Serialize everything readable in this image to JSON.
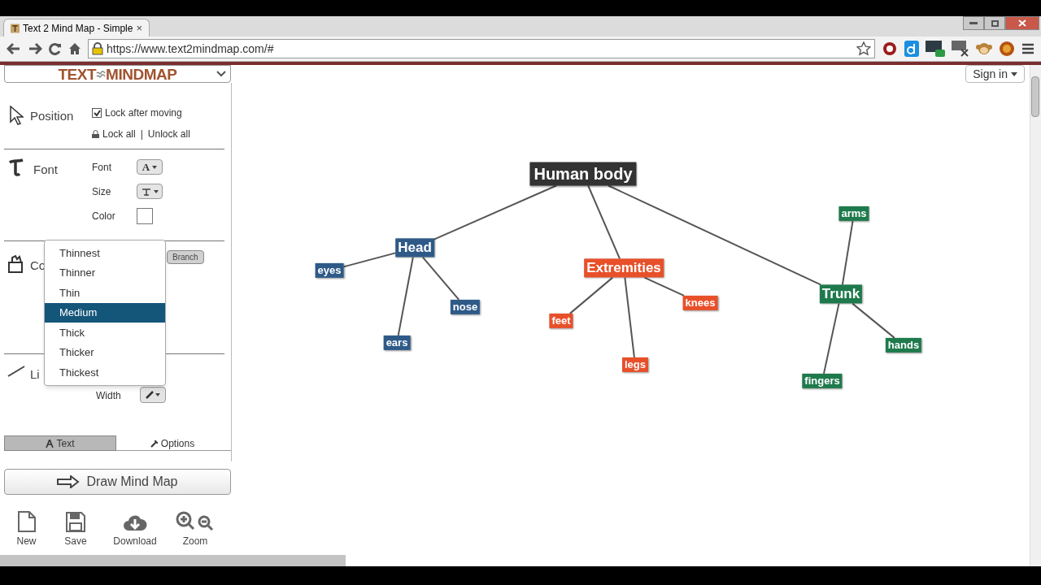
{
  "browser": {
    "tab": {
      "title": "Text 2 Mind Map - Simple",
      "close": "×"
    },
    "url": "https://www.text2mindmap.com/#"
  },
  "logo": {
    "left": "TEXT",
    "right": "MINDMAP"
  },
  "sign_in": "Sign in",
  "position": {
    "title": "Position",
    "lock_after_moving": {
      "label": "Lock after moving",
      "checked": true
    },
    "lock_all": "Lock all",
    "separator": "|",
    "unlock_all": "Unlock all"
  },
  "font": {
    "title": "Font",
    "fields": [
      {
        "label": "Font",
        "kind": "letter",
        "value": "A"
      },
      {
        "label": "Size",
        "kind": "size"
      },
      {
        "label": "Color",
        "kind": "swatch"
      }
    ]
  },
  "color_section": {
    "title": "Co",
    "branch_button": "Branch"
  },
  "line_section": {
    "title": "Li",
    "width_label": "Width"
  },
  "width_menu": {
    "items": [
      {
        "label": "Thinnest",
        "selected": false
      },
      {
        "label": "Thinner",
        "selected": false
      },
      {
        "label": "Thin",
        "selected": false
      },
      {
        "label": "Medium",
        "selected": true
      },
      {
        "label": "Thick",
        "selected": false
      },
      {
        "label": "Thicker",
        "selected": false
      },
      {
        "label": "Thickest",
        "selected": false
      }
    ]
  },
  "tabs": [
    {
      "label": "Text",
      "kind": "text",
      "selected": true
    },
    {
      "label": "Options",
      "kind": "options",
      "selected": false
    }
  ],
  "draw_button": "Draw Mind Map",
  "tools": [
    {
      "kind": "new",
      "label": "New"
    },
    {
      "kind": "save",
      "label": "Save"
    },
    {
      "kind": "download",
      "label": "Download"
    },
    {
      "kind": "zoom",
      "label": "Zoom"
    }
  ],
  "mind_map": {
    "root": {
      "label": "Human body",
      "color": "#333333",
      "children": [
        {
          "label": "Head",
          "color": "#2e5a88",
          "children": [
            {
              "label": "eyes",
              "color": "#2e5a88"
            },
            {
              "label": "nose",
              "color": "#2e5a88"
            },
            {
              "label": "ears",
              "color": "#2e5a88"
            }
          ]
        },
        {
          "label": "Extremities",
          "color": "#e8502a",
          "children": [
            {
              "label": "feet",
              "color": "#e8502a"
            },
            {
              "label": "legs",
              "color": "#e8502a"
            },
            {
              "label": "knees",
              "color": "#e8502a"
            }
          ]
        },
        {
          "label": "Trunk",
          "color": "#1e7a4c",
          "children": [
            {
              "label": "arms",
              "color": "#1e7a4c"
            },
            {
              "label": "fingers",
              "color": "#1e7a4c"
            },
            {
              "label": "hands",
              "color": "#1e7a4c"
            }
          ]
        }
      ]
    }
  }
}
